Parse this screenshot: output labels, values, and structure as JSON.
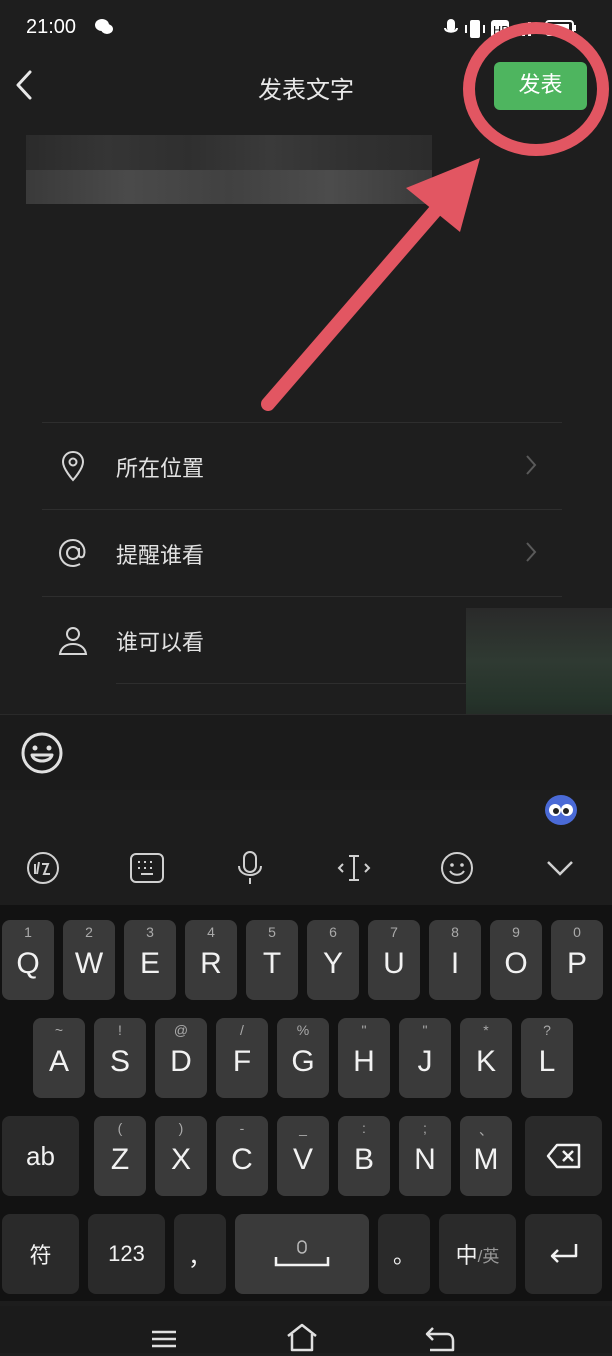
{
  "status_bar": {
    "time": "21:00"
  },
  "header": {
    "title": "发表文字",
    "publish_label": "发表",
    "annotation_color": "#e25662",
    "accent": "#4eb55f"
  },
  "options": [
    {
      "label": "所在位置",
      "icon": "location-pin-icon",
      "has_chevron": true
    },
    {
      "label": "提醒谁看",
      "icon": "at-sign-icon",
      "has_chevron": true
    },
    {
      "label": "谁可以看",
      "icon": "person-icon",
      "has_chevron": false
    }
  ],
  "keyboard": {
    "tools": [
      "handwriting-icon",
      "keyboard-icon",
      "microphone-icon",
      "cursor-icon",
      "emoji-icon",
      "collapse-icon"
    ],
    "row1": [
      {
        "k": "Q",
        "s": "1"
      },
      {
        "k": "W",
        "s": "2"
      },
      {
        "k": "E",
        "s": "3"
      },
      {
        "k": "R",
        "s": "4"
      },
      {
        "k": "T",
        "s": "5"
      },
      {
        "k": "Y",
        "s": "6"
      },
      {
        "k": "U",
        "s": "7"
      },
      {
        "k": "I",
        "s": "8"
      },
      {
        "k": "O",
        "s": "9"
      },
      {
        "k": "P",
        "s": "0"
      }
    ],
    "row2": [
      {
        "k": "A",
        "s": "~"
      },
      {
        "k": "S",
        "s": "!"
      },
      {
        "k": "D",
        "s": "@"
      },
      {
        "k": "F",
        "s": "/"
      },
      {
        "k": "G",
        "s": "%"
      },
      {
        "k": "H",
        "s": "\""
      },
      {
        "k": "J",
        "s": "\""
      },
      {
        "k": "K",
        "s": "*"
      },
      {
        "k": "L",
        "s": "?"
      }
    ],
    "row3": [
      {
        "k": "Z",
        "s": "("
      },
      {
        "k": "X",
        "s": ")"
      },
      {
        "k": "C",
        "s": "-"
      },
      {
        "k": "V",
        "s": "_"
      },
      {
        "k": "B",
        "s": ":"
      },
      {
        "k": "N",
        "s": ";"
      },
      {
        "k": "M",
        "s": "、"
      }
    ],
    "shift_label": "ab",
    "symbol_label": "符",
    "num_label": "123",
    "comma_label": "，",
    "period_label": "。",
    "lang_label_primary": "中",
    "lang_label_secondary": "/英"
  }
}
